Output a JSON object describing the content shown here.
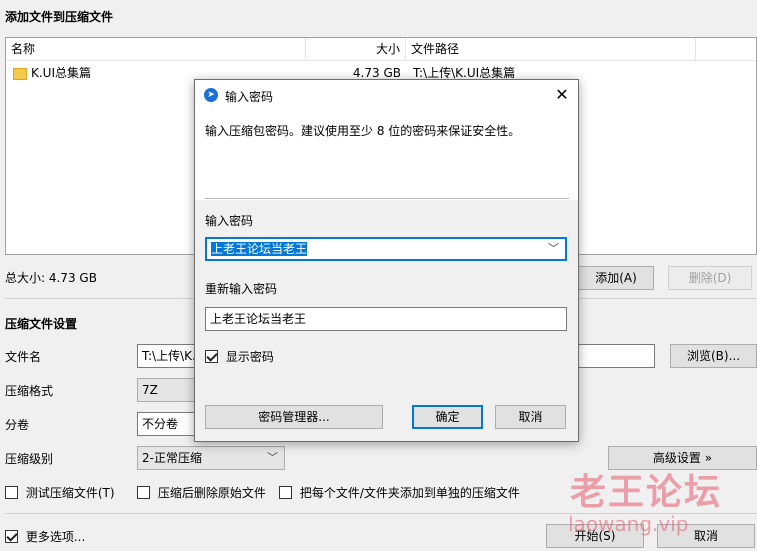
{
  "files_section": {
    "title": "添加文件到压缩文件",
    "columns": {
      "name": "名称",
      "size": "大小",
      "path": "文件路径"
    },
    "rows": [
      {
        "name": "K.UI总集篇",
        "size": "4.73 GB",
        "path": "T:\\上传\\K.UI总集篇"
      }
    ],
    "total": "总大小: 4.73 GB",
    "add_label": "添加(A)",
    "delete_label": "删除(D)"
  },
  "settings": {
    "title": "压缩文件设置",
    "filename_label": "文件名",
    "filename_value": "T:\\上传\\K.",
    "browse_label": "浏览(B)...",
    "format_label": "压缩格式",
    "format_value": "7Z",
    "split_label": "分卷",
    "split_value": "不分卷",
    "level_label": "压缩级别",
    "level_value": "2-正常压缩",
    "advanced_label": "高级设置 »",
    "test_label": "测试压缩文件(T)",
    "delete_after_label": "压缩后删除原始文件",
    "separate_label": "把每个文件/文件夹添加到单独的压缩文件"
  },
  "footer": {
    "more_options_label": "更多选项...",
    "start_label": "开始(S)",
    "cancel_label": "取消"
  },
  "dialog": {
    "title": "输入密码",
    "info": "输入压缩包密码。建议使用至少 8 位的密码来保证安全性。",
    "password_label": "输入密码",
    "password_value": "上老王论坛当老王",
    "reenter_label": "重新输入密码",
    "reenter_value": "上老王论坛当老王",
    "show_password_label": "显示密码",
    "manager_label": "密码管理器...",
    "ok_label": "确定",
    "cancel_label": "取消"
  },
  "watermark": {
    "main": "老王论坛",
    "sub": "laowang.vip"
  },
  "colors": {
    "accent": "#0078d7",
    "watermark": "#e85a6e"
  }
}
